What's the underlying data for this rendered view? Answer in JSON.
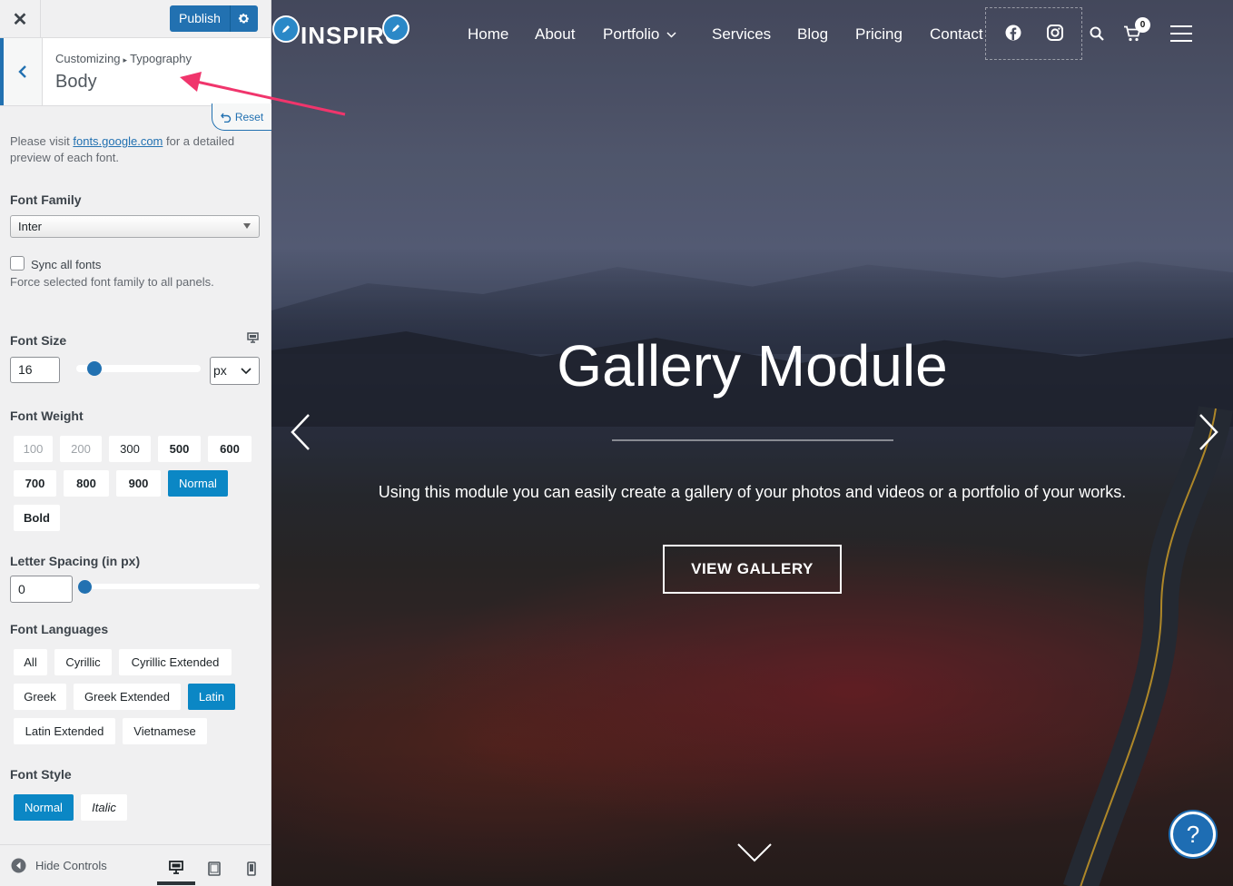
{
  "topbar": {
    "close_label": "✕",
    "publish_label": "Publish"
  },
  "section": {
    "breadcrumb_parent": "Customizing",
    "breadcrumb_current": "Typography",
    "title": "Body",
    "reset_label": "Reset"
  },
  "fonts_help": {
    "prefix": "Please visit ",
    "link": "fonts.google.com",
    "suffix": " for a detailed preview of each font."
  },
  "font_family": {
    "label": "Font Family",
    "value": "Inter"
  },
  "sync": {
    "label": "Sync all fonts",
    "checked": false,
    "help": "Force selected font family to all panels."
  },
  "font_size": {
    "label": "Font Size",
    "value": "16",
    "unit": "px"
  },
  "font_weight": {
    "label": "Font Weight",
    "options": [
      "100",
      "200",
      "300",
      "500",
      "600",
      "700",
      "800",
      "900",
      "Normal",
      "Bold"
    ],
    "selected": "Normal"
  },
  "letter_spacing": {
    "label": "Letter Spacing (in px)",
    "value": "0"
  },
  "font_languages": {
    "label": "Font Languages",
    "options": [
      "All",
      "Cyrillic",
      "Cyrillic Extended",
      "Greek",
      "Greek Extended",
      "Latin",
      "Latin Extended",
      "Vietnamese"
    ],
    "selected": "Latin"
  },
  "font_style": {
    "label": "Font Style",
    "options": [
      "Normal",
      "Italic"
    ],
    "selected": "Normal"
  },
  "footer": {
    "hide_controls": "Hide Controls",
    "active_device": "desktop"
  },
  "preview": {
    "logo": "INSPIRO",
    "nav": [
      "Home",
      "About",
      "Portfolio",
      "Services",
      "Blog",
      "Pricing",
      "Contact"
    ],
    "cart_count": "0",
    "hero_title": "Gallery Module",
    "hero_subtitle": "Using this module you can easily create a gallery of your photos and videos or a portfolio of your works.",
    "cta": "VIEW GALLERY",
    "help": "?"
  },
  "colors": {
    "accent": "#2271b1",
    "chip_active": "#0b87c5",
    "annotation": "#f0356c"
  }
}
